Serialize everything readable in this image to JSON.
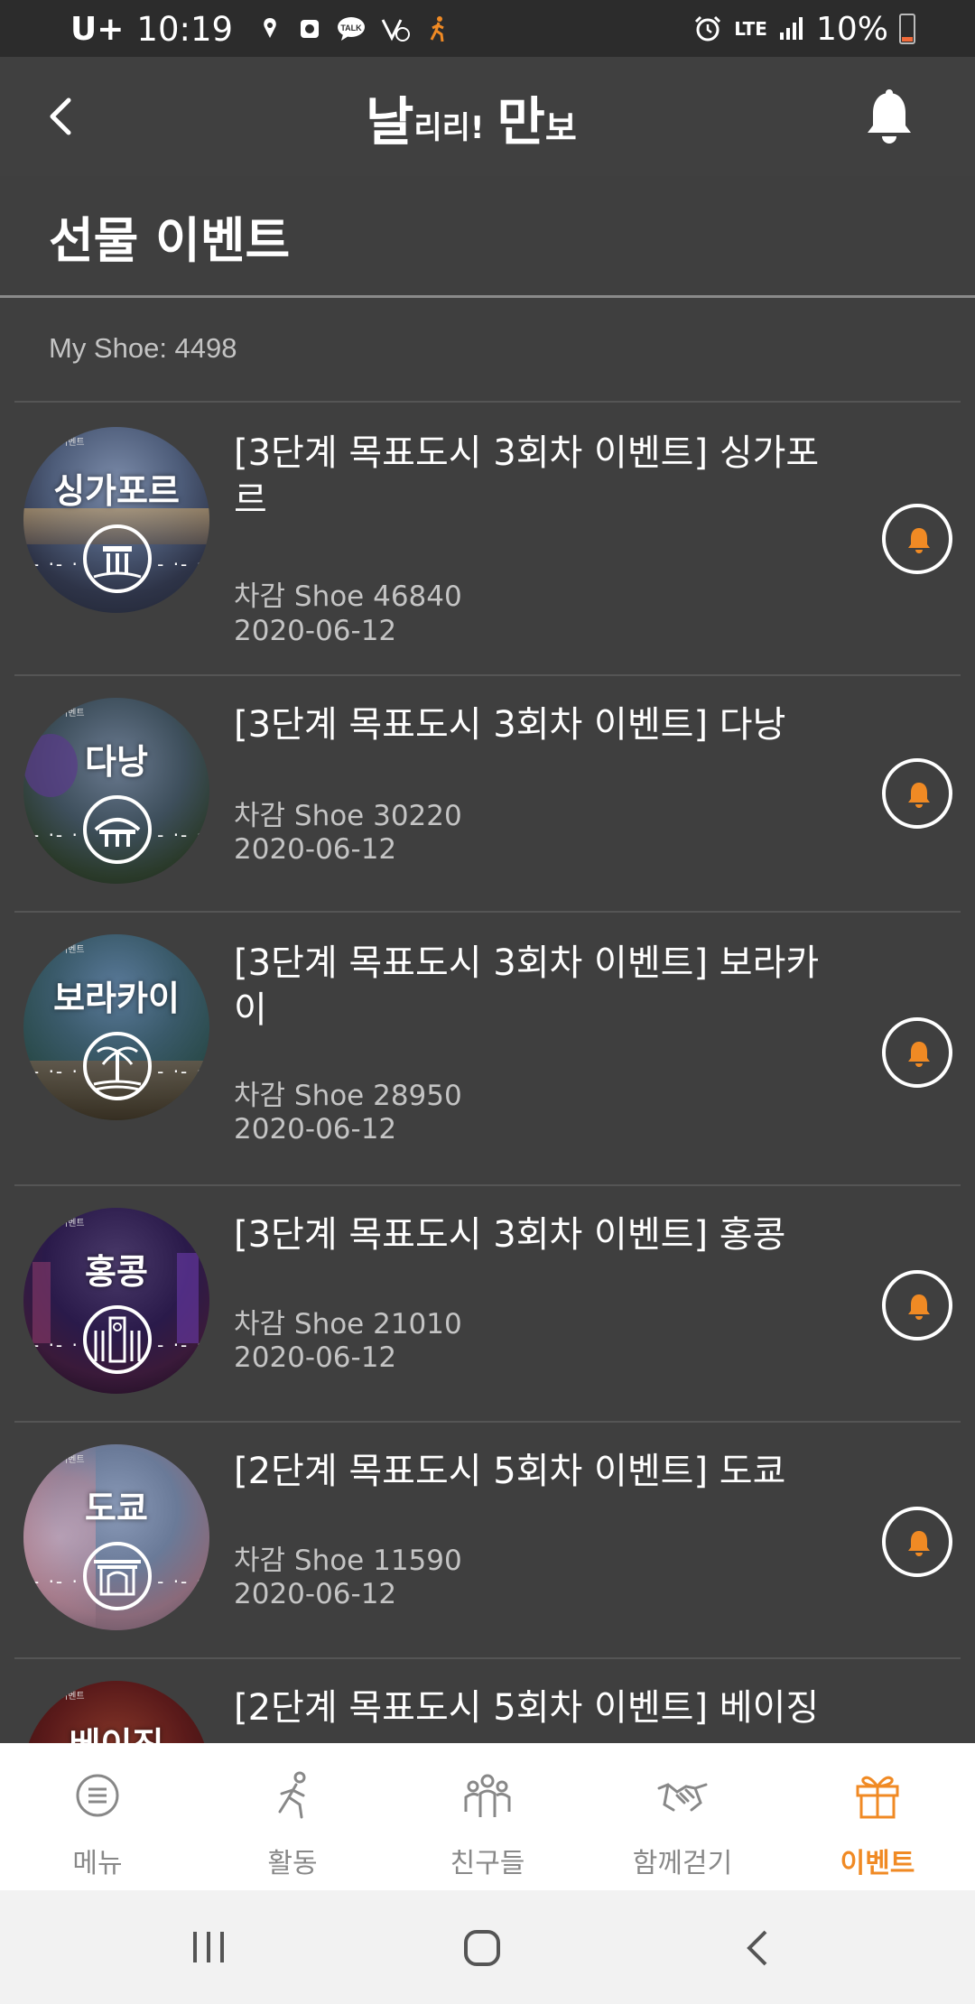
{
  "status_bar": {
    "carrier": "U+",
    "time": "10:19",
    "network": "LTE",
    "battery": "10%",
    "icons": [
      "location-icon",
      "media-icon",
      "talk-icon",
      "wifi-call-icon",
      "walk-icon",
      "alarm-icon",
      "signal-icon",
      "battery-icon"
    ]
  },
  "header": {
    "logo_parts": [
      "날",
      "리리!",
      "만",
      "보"
    ],
    "back_icon": "chevron-left-icon",
    "notification_icon": "bell-icon"
  },
  "page": {
    "title": "선물 이벤트",
    "my_shoe": "My Shoe: 4498"
  },
  "events": [
    {
      "thumb_label": "싱가포르",
      "thumb_small": "이벤트",
      "title": "[3단계 목표도시 3회차 이벤트] 싱가포르",
      "cost": "차감 Shoe 46840",
      "date": "2020-06-12"
    },
    {
      "thumb_label": "다낭",
      "thumb_small": "이벤트",
      "title": "[3단계 목표도시 3회차 이벤트] 다낭",
      "cost": "차감 Shoe 30220",
      "date": "2020-06-12"
    },
    {
      "thumb_label": "보라카이",
      "thumb_small": "이벤트",
      "title": "[3단계 목표도시 3회차 이벤트] 보라카이",
      "cost": "차감 Shoe 28950",
      "date": "2020-06-12"
    },
    {
      "thumb_label": "홍콩",
      "thumb_small": "이벤트",
      "title": "[3단계 목표도시 3회차 이벤트] 홍콩",
      "cost": "차감 Shoe 21010",
      "date": "2020-06-12"
    },
    {
      "thumb_label": "도쿄",
      "thumb_small": "이벤트",
      "title": "[2단계 목표도시 5회차 이벤트] 도쿄",
      "cost": "차감 Shoe 11590",
      "date": "2020-06-12"
    },
    {
      "thumb_label": "베이징",
      "thumb_small": "이벤트",
      "title": "[2단계 목표도시 5회차 이벤트] 베이징",
      "cost": "",
      "date": ""
    }
  ],
  "bottom_nav": [
    {
      "label": "메뉴",
      "icon": "menu-icon",
      "active": false
    },
    {
      "label": "활동",
      "icon": "running-icon",
      "active": false
    },
    {
      "label": "친구들",
      "icon": "friends-icon",
      "active": false
    },
    {
      "label": "함께걷기",
      "icon": "handshake-icon",
      "active": false
    },
    {
      "label": "이벤트",
      "icon": "gift-icon",
      "active": true
    }
  ],
  "colors": {
    "background": "#3f3f3f",
    "accent": "#f08a24",
    "status_bar": "#2c2c2c",
    "nav_bg": "#ffffff"
  }
}
